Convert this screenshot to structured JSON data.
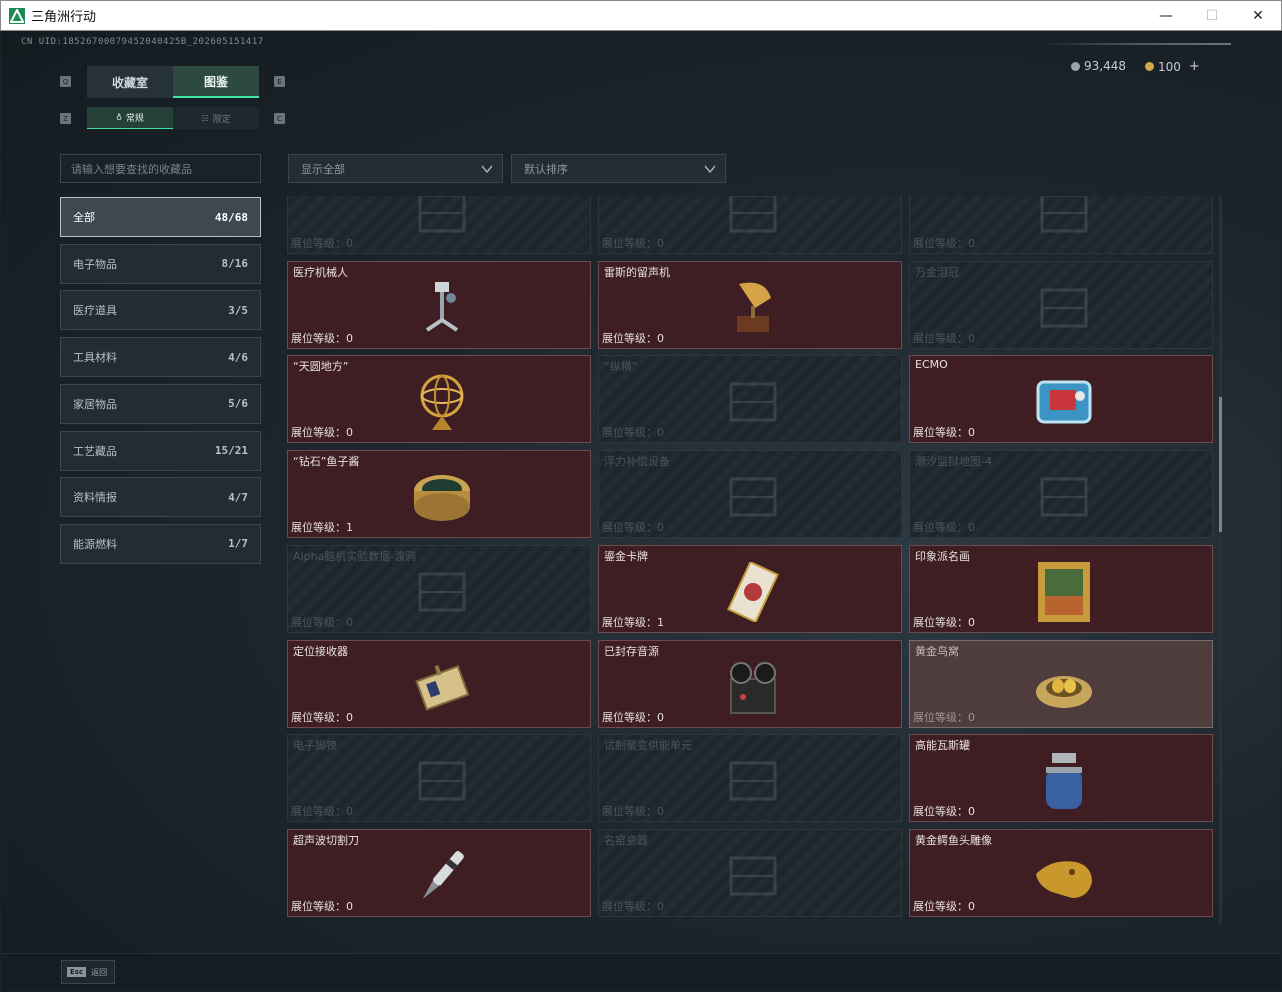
{
  "window": {
    "title": "三角洲行动",
    "minimize": "—",
    "maximize": "☐",
    "close": "✕"
  },
  "uid": "CN UID:18526700079452040425B_202605151417",
  "currency": {
    "coins": "93,448",
    "tickets": "100",
    "plus": "+"
  },
  "tabs": {
    "key_left": "Q",
    "key_right": "E",
    "collection": "收藏室",
    "catalog": "图鉴"
  },
  "subtabs": {
    "key_left": "Z",
    "key_right": "C",
    "normal": "常规",
    "limited": "限定"
  },
  "search": {
    "placeholder": "请输入想要查找的收藏品"
  },
  "filters": {
    "display": "显示全部",
    "sort": "默认排序"
  },
  "categories": [
    {
      "label": "全部",
      "count": "48/68"
    },
    {
      "label": "电子物品",
      "count": "8/16"
    },
    {
      "label": "医疗道具",
      "count": "3/5"
    },
    {
      "label": "工具材料",
      "count": "4/6"
    },
    {
      "label": "家居物品",
      "count": "5/6"
    },
    {
      "label": "工艺藏品",
      "count": "15/21"
    },
    {
      "label": "资料情报",
      "count": "4/7"
    },
    {
      "label": "能源燃料",
      "count": "1/7"
    }
  ],
  "level_label": "展位等级：",
  "items": [
    {
      "name": "",
      "level": "0",
      "state": "locked",
      "icon": "machine-icon"
    },
    {
      "name": "",
      "level": "0",
      "state": "locked",
      "icon": "machine-icon"
    },
    {
      "name": "",
      "level": "0",
      "state": "locked",
      "icon": "machine-icon"
    },
    {
      "name": "医疗机械人",
      "level": "0",
      "state": "unlocked",
      "icon": "medical-robot-icon"
    },
    {
      "name": "雷斯的留声机",
      "level": "0",
      "state": "unlocked",
      "icon": "gramophone-icon"
    },
    {
      "name": "万金泪冠",
      "level": "0",
      "state": "locked",
      "icon": "crown-icon"
    },
    {
      "name": "“天圆地方”",
      "level": "0",
      "state": "unlocked",
      "icon": "armillary-sphere-icon"
    },
    {
      "name": "“纵横”",
      "level": "0",
      "state": "locked",
      "icon": "chessboard-icon"
    },
    {
      "name": "ECMO",
      "level": "0",
      "state": "unlocked",
      "icon": "ecmo-machine-icon"
    },
    {
      "name": "“钻石”鱼子酱",
      "level": "1",
      "state": "unlocked",
      "icon": "caviar-tin-icon"
    },
    {
      "name": "浮力补偿设备",
      "level": "0",
      "state": "locked",
      "icon": "diving-gear-icon"
    },
    {
      "name": "潮汐监狱地图-4",
      "level": "0",
      "state": "locked",
      "icon": "map-icon"
    },
    {
      "name": "Alpha脑机实验数据-渡鸦",
      "level": "0",
      "state": "locked",
      "icon": "data-drive-icon"
    },
    {
      "name": "鎏金卡牌",
      "level": "1",
      "state": "unlocked",
      "icon": "gilded-card-icon"
    },
    {
      "name": "印象派名画",
      "level": "0",
      "state": "unlocked",
      "icon": "painting-icon"
    },
    {
      "name": "定位接收器",
      "level": "0",
      "state": "unlocked",
      "icon": "receiver-icon"
    },
    {
      "name": "已封存音源",
      "level": "0",
      "state": "unlocked",
      "icon": "reel-recorder-icon"
    },
    {
      "name": "黄金鸟窝",
      "level": "0",
      "state": "highlight",
      "icon": "golden-nest-icon"
    },
    {
      "name": "电子脚镣",
      "level": "0",
      "state": "locked",
      "icon": "ankle-monitor-icon"
    },
    {
      "name": "试制聚变供能单元",
      "level": "0",
      "state": "locked",
      "icon": "fusion-cell-icon"
    },
    {
      "name": "高能瓦斯罐",
      "level": "0",
      "state": "unlocked",
      "icon": "gas-canister-icon"
    },
    {
      "name": "超声波切割刀",
      "level": "0",
      "state": "unlocked",
      "icon": "ultrasonic-knife-icon"
    },
    {
      "name": "名窑瓷器",
      "level": "0",
      "state": "locked",
      "icon": "porcelain-vase-icon"
    },
    {
      "name": "黄金鳄鱼头雕像",
      "level": "0",
      "state": "unlocked",
      "icon": "gold-croc-head-icon"
    }
  ],
  "bottom": {
    "esc_key": "Esc",
    "esc_label": "返回"
  },
  "colors": {
    "accent": "#3fe6a3",
    "card_unlocked": "#3e1e23",
    "card_locked": "#1e262c"
  }
}
